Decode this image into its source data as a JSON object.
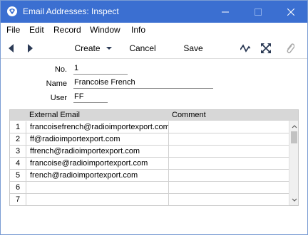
{
  "window": {
    "title": "Email Addresses: Inspect"
  },
  "menubar": {
    "items": [
      "File",
      "Edit",
      "Record",
      "Window",
      "Info"
    ]
  },
  "toolbar": {
    "create_label": "Create",
    "cancel_label": "Cancel",
    "save_label": "Save"
  },
  "fields": {
    "no_label": "No.",
    "no_value": "1",
    "name_label": "Name",
    "name_value": "Francoise French",
    "user_label": "User",
    "user_value": "FF"
  },
  "grid": {
    "columns": [
      "External Email",
      "Comment"
    ],
    "rows": [
      {
        "num": "1",
        "email": "francoisefrench@radioimportexport.com",
        "comment": ""
      },
      {
        "num": "2",
        "email": "ff@radioimportexport.com",
        "comment": ""
      },
      {
        "num": "3",
        "email": "ffrench@radioimportexport.com",
        "comment": ""
      },
      {
        "num": "4",
        "email": "francoise@radioimportexport.com",
        "comment": ""
      },
      {
        "num": "5",
        "email": "french@radioimportexport.com",
        "comment": ""
      },
      {
        "num": "6",
        "email": "",
        "comment": ""
      },
      {
        "num": "7",
        "email": "",
        "comment": ""
      }
    ]
  },
  "colors": {
    "titlebar": "#3b6fd1",
    "grid_header": "#d7d7d7"
  }
}
